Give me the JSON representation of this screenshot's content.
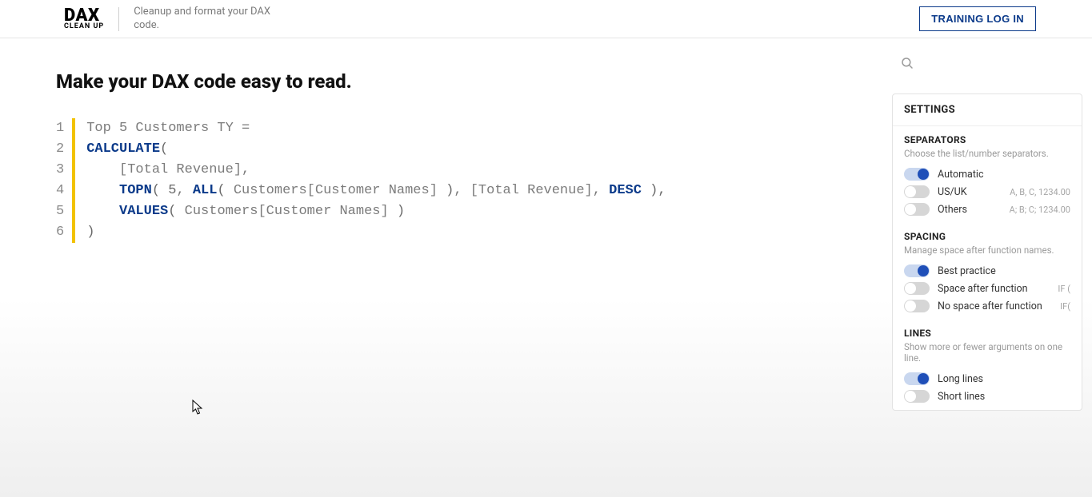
{
  "header": {
    "logo_main": "DAX",
    "logo_sub": "CLEAN UP",
    "tagline": "Cleanup and format your DAX code.",
    "login_label": "TRAINING LOG IN"
  },
  "page_title": "Make your DAX code easy to read.",
  "code": {
    "lines": [
      {
        "n": "1",
        "tokens": [
          {
            "t": "Top 5 Customers TY =",
            "c": "tok-plain"
          }
        ]
      },
      {
        "n": "2",
        "tokens": [
          {
            "t": "CALCULATE",
            "c": "tok-fn"
          },
          {
            "t": "(",
            "c": "tok-paren"
          }
        ]
      },
      {
        "n": "3",
        "tokens": [
          {
            "t": "    ",
            "c": "tok-plain"
          },
          {
            "t": "[Total Revenue],",
            "c": "tok-plain"
          }
        ]
      },
      {
        "n": "4",
        "tokens": [
          {
            "t": "    ",
            "c": "tok-plain"
          },
          {
            "t": "TOPN",
            "c": "tok-fn"
          },
          {
            "t": "( ",
            "c": "tok-paren"
          },
          {
            "t": "5",
            "c": "tok-num"
          },
          {
            "t": ", ",
            "c": "tok-plain"
          },
          {
            "t": "ALL",
            "c": "tok-fn"
          },
          {
            "t": "( ",
            "c": "tok-paren"
          },
          {
            "t": "Customers[Customer Names] ",
            "c": "tok-plain"
          },
          {
            "t": ")",
            "c": "tok-paren"
          },
          {
            "t": ", [Total Revenue], ",
            "c": "tok-plain"
          },
          {
            "t": "DESC",
            "c": "tok-kw"
          },
          {
            "t": " ",
            "c": "tok-plain"
          },
          {
            "t": "),",
            "c": "tok-paren"
          }
        ]
      },
      {
        "n": "5",
        "tokens": [
          {
            "t": "    ",
            "c": "tok-plain"
          },
          {
            "t": "VALUES",
            "c": "tok-fn"
          },
          {
            "t": "( ",
            "c": "tok-paren"
          },
          {
            "t": "Customers[Customer Names] ",
            "c": "tok-plain"
          },
          {
            "t": ")",
            "c": "tok-paren"
          }
        ]
      },
      {
        "n": "6",
        "tokens": [
          {
            "t": ")",
            "c": "tok-paren"
          }
        ]
      }
    ]
  },
  "settings": {
    "header": "SETTINGS",
    "sections": [
      {
        "title": "SEPARATORS",
        "desc": "Choose the list/number separators.",
        "options": [
          {
            "label": "Automatic",
            "hint": "",
            "on": true
          },
          {
            "label": "US/UK",
            "hint": "A, B, C, 1234.00",
            "on": false
          },
          {
            "label": "Others",
            "hint": "A; B; C; 1234.00",
            "on": false
          }
        ]
      },
      {
        "title": "SPACING",
        "desc": "Manage space after function names.",
        "options": [
          {
            "label": "Best practice",
            "hint": "",
            "on": true
          },
          {
            "label": "Space after function",
            "hint": "IF (",
            "on": false
          },
          {
            "label": "No space after function",
            "hint": "IF(",
            "on": false
          }
        ]
      },
      {
        "title": "LINES",
        "desc": "Show more or fewer arguments on one line.",
        "options": [
          {
            "label": "Long lines",
            "hint": "",
            "on": true
          },
          {
            "label": "Short lines",
            "hint": "",
            "on": false
          }
        ]
      }
    ]
  }
}
